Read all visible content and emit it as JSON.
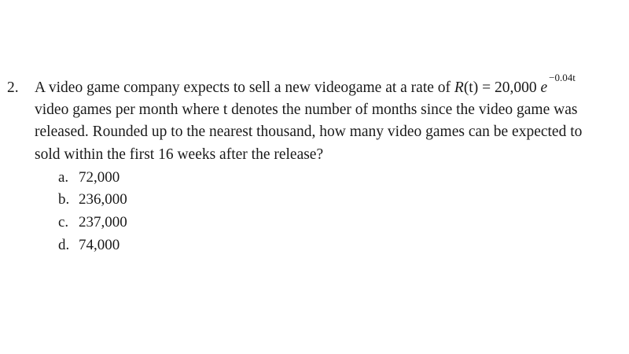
{
  "question": {
    "number": "2.",
    "line1_pre": "A video game company expects to sell a new videogame at a rate of ",
    "func_name": "R",
    "func_arg": "(t) = 20,000 ",
    "base": "e",
    "exponent": "−0.04t",
    "line2": "video games per month where t denotes the number of months since the video game was",
    "line3": "released. Rounded up to the nearest thousand, how many video games can be expected to",
    "line4": "sold within the first 16 weeks after the release?",
    "options": [
      {
        "letter": "a.",
        "value": "72,000"
      },
      {
        "letter": "b.",
        "value": "236,000"
      },
      {
        "letter": "c.",
        "value": "237,000"
      },
      {
        "letter": "d.",
        "value": "74,000"
      }
    ]
  }
}
